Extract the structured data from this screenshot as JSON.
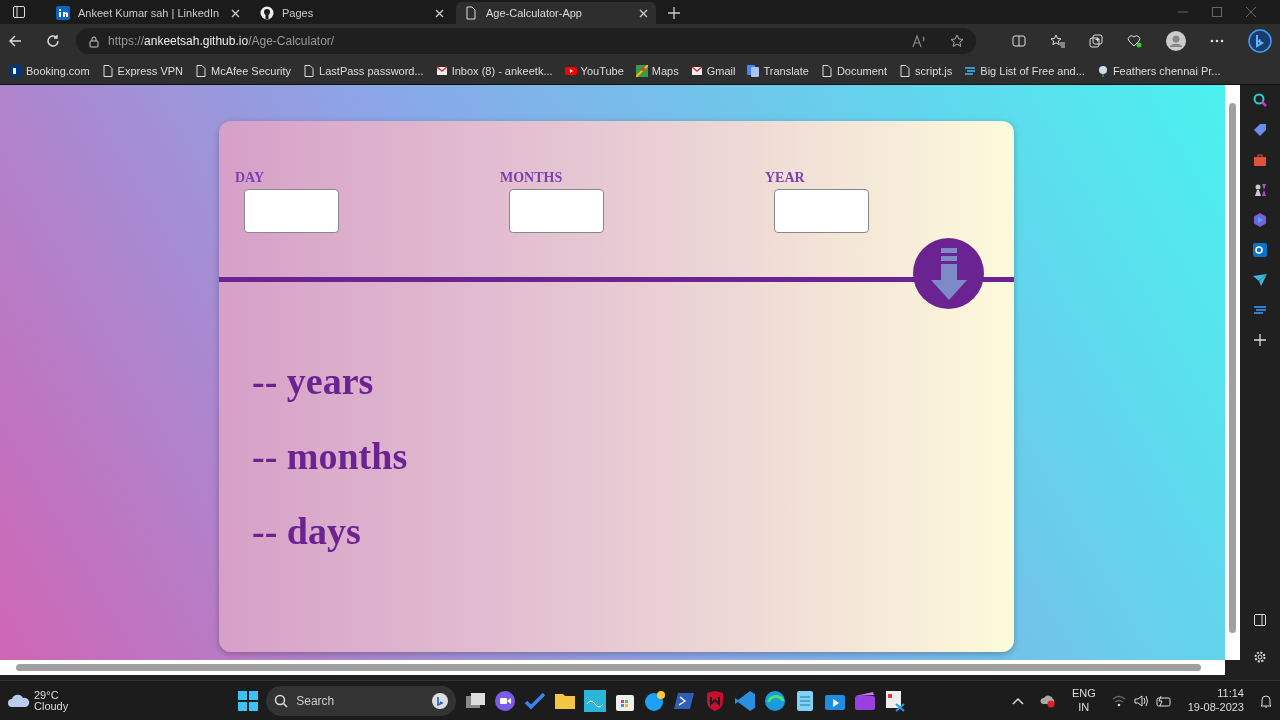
{
  "tabs": [
    {
      "title": "Ankeet Kumar sah | LinkedIn",
      "selected": false
    },
    {
      "title": "Pages",
      "selected": false
    },
    {
      "title": "Age-Calculator-App",
      "selected": true
    }
  ],
  "address": {
    "scheme": "https://",
    "host": "ankeetsah.github.io",
    "path": "/Age-Calculator/"
  },
  "bookmarks": [
    "Booking.com",
    "Express VPN",
    "McAfee Security",
    "LastPass password...",
    "Inbox (8) - ankeetk...",
    "YouTube",
    "Maps",
    "Gmail",
    "Translate",
    "Document",
    "script.js",
    "Big List of Free and...",
    "Feathers chennai Pr..."
  ],
  "page": {
    "fields": [
      {
        "label": "DAY"
      },
      {
        "label": "MONTHS"
      },
      {
        "label": "YEAR"
      }
    ],
    "results": [
      "-- years",
      "-- months",
      "-- days"
    ]
  },
  "taskbar": {
    "temperature": "29°C",
    "weather": "Cloudy",
    "search_placeholder": "Search",
    "language": "ENG",
    "region": "IN",
    "time": "11:14",
    "date": "19-08-2023"
  }
}
